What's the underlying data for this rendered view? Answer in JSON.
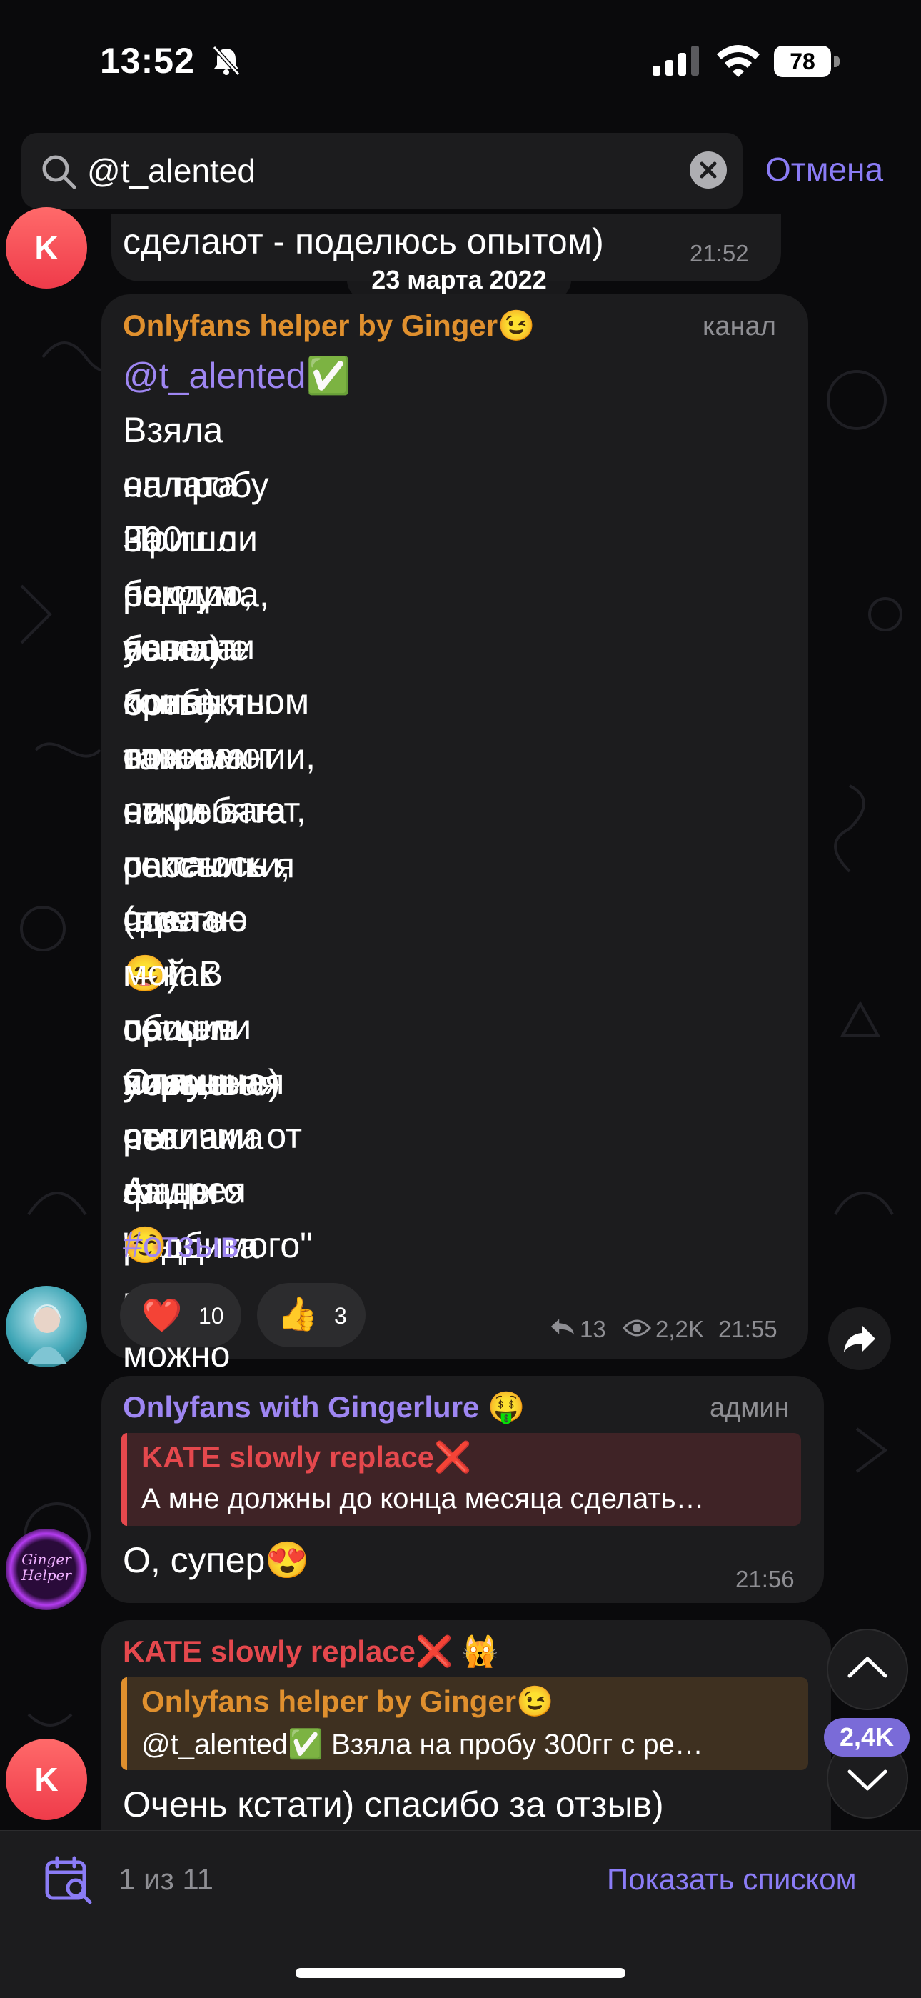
{
  "status_bar": {
    "time": "13:52",
    "battery": "78"
  },
  "search": {
    "query": "@t_alented",
    "cancel_label": "Отмена"
  },
  "messages": {
    "prev_fragment": {
      "text": "сделают - поделюсь опытом)",
      "time": "21:52"
    },
    "date_separator": "23 марта 2022",
    "post": {
      "sender": "Onlyfans helper by Ginger😉",
      "role": "канал",
      "mention": "@t_alented✅",
      "lines": [
        "Взяла на пробу 300гг с реддита,",
        "оплата на паксум была)",
        "Пришли быстро, явно не боты) я",
        "не успела особо там с ними",
        "навести контакты в моем",
        "привычном понимании, но ребята",
        "отвечают на рассылки, что-то",
        "открывают, секстить я пока не",
        "пытаюсь (все никак сеты новые не",
        "сделаю 😄). В общем учитывая",
        "мой пассив вижу, что фаны",
        "пришли хорошие)",
        "Отличная реклама с реддита в",
        "отличии от нашего \"любимого\"",
        "Андрея☺️ смело можно брать❤️"
      ],
      "hashtag": "#отзыв",
      "reactions": [
        {
          "emoji": "❤️",
          "count": "10"
        },
        {
          "emoji": "👍",
          "count": "3"
        }
      ],
      "replies": "13",
      "views": "2,2K",
      "time": "21:55"
    },
    "reply1": {
      "sender": "Onlyfans with Gingerlure 🤑",
      "role": "админ",
      "quote_author": "KATE slowly replace❌",
      "quote_text": "А мне должны до конца месяца сделать…",
      "text": "О, супер😍",
      "time": "21:56"
    },
    "reply2": {
      "sender": "KATE slowly replace❌ 🙀",
      "quote_author": "Onlyfans helper by Ginger😉",
      "quote_text": "@t_alented✅ Взяла на пробу 300гг с ре…",
      "text": "Очень кстати) спасибо за отзыв)"
    },
    "avatar_letter": "K"
  },
  "unread_badge": "2,4K",
  "bottom": {
    "results": "1 из 11",
    "show_list": "Показать списком"
  },
  "colors": {
    "accent": "#8b7cf6",
    "bubble": "#1c1c1e",
    "orange_name": "#e0902e",
    "purple_name": "#9e86f2",
    "red_name": "#e5484d"
  }
}
